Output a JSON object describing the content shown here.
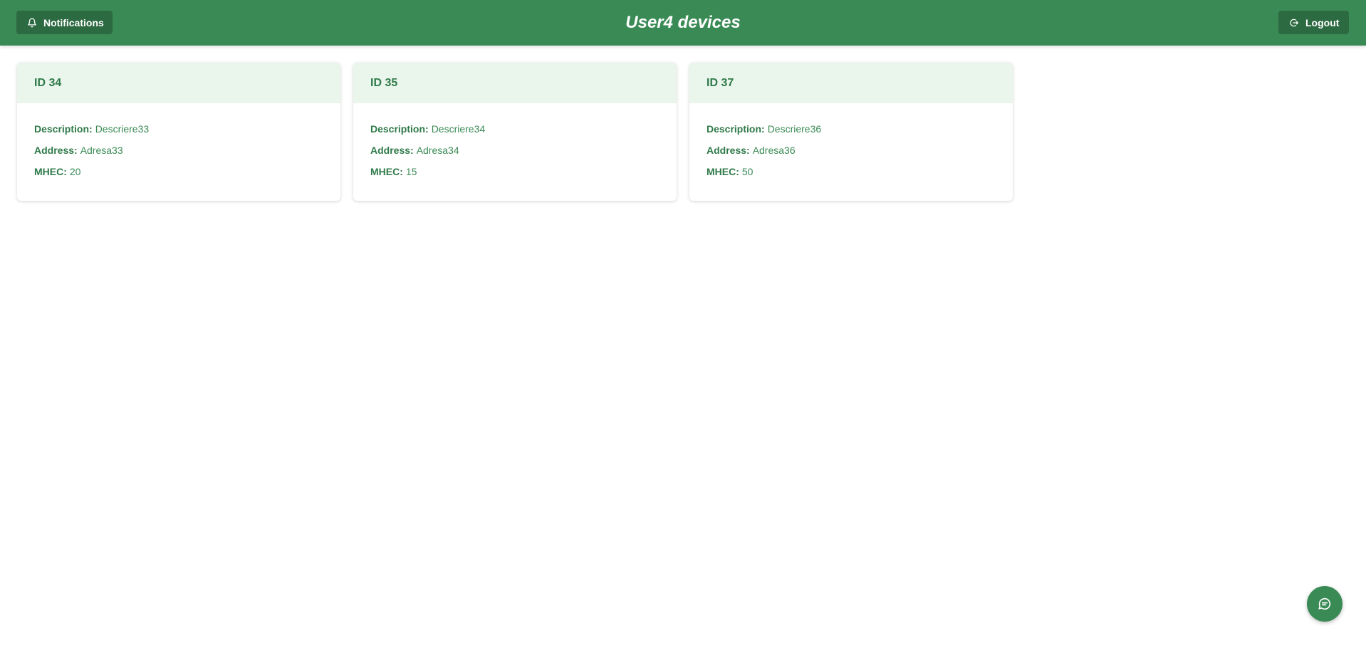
{
  "header": {
    "title": "User4 devices",
    "notifications_label": "Notifications",
    "logout_label": "Logout",
    "bar_color": "#3a8a55"
  },
  "devices": [
    {
      "id_label": "ID 34",
      "description_label": "Description:",
      "description": "Descriere33",
      "address_label": "Address:",
      "address": "Adresa33",
      "mhec_label": "MHEC:",
      "mhec": "20"
    },
    {
      "id_label": "ID 35",
      "description_label": "Description:",
      "description": "Descriere34",
      "address_label": "Address:",
      "address": "Adresa34",
      "mhec_label": "MHEC:",
      "mhec": "15"
    },
    {
      "id_label": "ID 37",
      "description_label": "Description:",
      "description": "Descriere36",
      "address_label": "Address:",
      "address": "Adresa36",
      "mhec_label": "MHEC:",
      "mhec": "50"
    }
  ],
  "icons": {
    "notifications": "bell-icon",
    "logout": "logout-icon",
    "chat": "chat-icon"
  }
}
